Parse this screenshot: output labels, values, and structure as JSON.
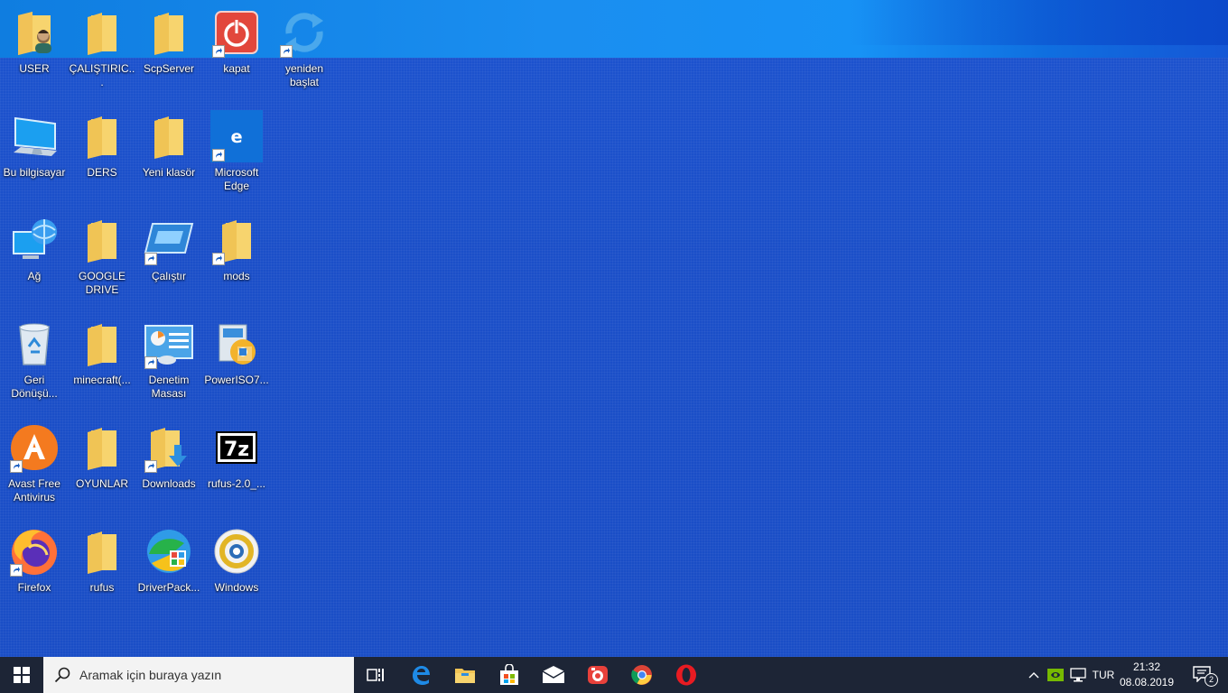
{
  "desktop_icons": [
    {
      "label": "USER",
      "kind": "user-folder"
    },
    {
      "label": "ÇALIŞTIRIC...",
      "kind": "folder"
    },
    {
      "label": "ScpServer",
      "kind": "folder"
    },
    {
      "label": "kapat",
      "kind": "power"
    },
    {
      "label": "yeniden başlat",
      "kind": "restart"
    },
    {
      "label": "Bu bilgisayar",
      "kind": "computer"
    },
    {
      "label": "DERS",
      "kind": "folder"
    },
    {
      "label": "Yeni klasör",
      "kind": "folder"
    },
    {
      "label": "Microsoft Edge",
      "kind": "edge"
    },
    {
      "label": "Ağ",
      "kind": "network"
    },
    {
      "label": "GOOGLE DRIVE",
      "kind": "folder"
    },
    {
      "label": "Çalıştır",
      "kind": "run"
    },
    {
      "label": "mods",
      "kind": "folder"
    },
    {
      "label": "Geri Dönüşü...",
      "kind": "recycle-bin"
    },
    {
      "label": "minecraft(...",
      "kind": "folder"
    },
    {
      "label": "Denetim Masası",
      "kind": "control-panel"
    },
    {
      "label": "PowerISO7...",
      "kind": "poweriso"
    },
    {
      "label": "Avast Free Antivirus",
      "kind": "avast"
    },
    {
      "label": "OYUNLAR",
      "kind": "folder"
    },
    {
      "label": "Downloads",
      "kind": "downloads"
    },
    {
      "label": "rufus-2.0_...",
      "kind": "7z"
    },
    {
      "label": "Firefox",
      "kind": "firefox"
    },
    {
      "label": "rufus",
      "kind": "folder"
    },
    {
      "label": "DriverPack...",
      "kind": "driverpack"
    },
    {
      "label": "Windows",
      "kind": "windows-disc"
    }
  ],
  "taskbar": {
    "search_placeholder": "Aramak için buraya yazın",
    "pinned": [
      "task-view",
      "edge",
      "file-explorer",
      "store",
      "mail",
      "app-red",
      "chrome",
      "opera"
    ],
    "tray_language": "TUR",
    "time": "21:32",
    "date": "08.08.2019",
    "notification_count": "2"
  },
  "colors": {
    "desktop": "#1a4fc7",
    "taskbar": "#1d2536",
    "folder": "#f5d26b"
  }
}
